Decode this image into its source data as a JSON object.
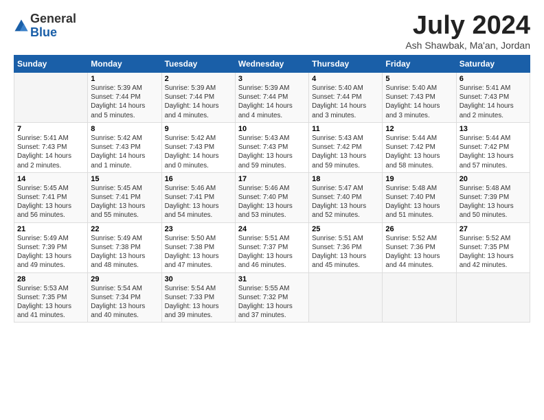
{
  "logo": {
    "general": "General",
    "blue": "Blue"
  },
  "title": "July 2024",
  "subtitle": "Ash Shawbak, Ma'an, Jordan",
  "headers": [
    "Sunday",
    "Monday",
    "Tuesday",
    "Wednesday",
    "Thursday",
    "Friday",
    "Saturday"
  ],
  "weeks": [
    [
      {
        "day": "",
        "info": ""
      },
      {
        "day": "1",
        "info": "Sunrise: 5:39 AM\nSunset: 7:44 PM\nDaylight: 14 hours\nand 5 minutes."
      },
      {
        "day": "2",
        "info": "Sunrise: 5:39 AM\nSunset: 7:44 PM\nDaylight: 14 hours\nand 4 minutes."
      },
      {
        "day": "3",
        "info": "Sunrise: 5:39 AM\nSunset: 7:44 PM\nDaylight: 14 hours\nand 4 minutes."
      },
      {
        "day": "4",
        "info": "Sunrise: 5:40 AM\nSunset: 7:44 PM\nDaylight: 14 hours\nand 3 minutes."
      },
      {
        "day": "5",
        "info": "Sunrise: 5:40 AM\nSunset: 7:43 PM\nDaylight: 14 hours\nand 3 minutes."
      },
      {
        "day": "6",
        "info": "Sunrise: 5:41 AM\nSunset: 7:43 PM\nDaylight: 14 hours\nand 2 minutes."
      }
    ],
    [
      {
        "day": "7",
        "info": "Sunrise: 5:41 AM\nSunset: 7:43 PM\nDaylight: 14 hours\nand 2 minutes."
      },
      {
        "day": "8",
        "info": "Sunrise: 5:42 AM\nSunset: 7:43 PM\nDaylight: 14 hours\nand 1 minute."
      },
      {
        "day": "9",
        "info": "Sunrise: 5:42 AM\nSunset: 7:43 PM\nDaylight: 14 hours\nand 0 minutes."
      },
      {
        "day": "10",
        "info": "Sunrise: 5:43 AM\nSunset: 7:43 PM\nDaylight: 13 hours\nand 59 minutes."
      },
      {
        "day": "11",
        "info": "Sunrise: 5:43 AM\nSunset: 7:42 PM\nDaylight: 13 hours\nand 59 minutes."
      },
      {
        "day": "12",
        "info": "Sunrise: 5:44 AM\nSunset: 7:42 PM\nDaylight: 13 hours\nand 58 minutes."
      },
      {
        "day": "13",
        "info": "Sunrise: 5:44 AM\nSunset: 7:42 PM\nDaylight: 13 hours\nand 57 minutes."
      }
    ],
    [
      {
        "day": "14",
        "info": "Sunrise: 5:45 AM\nSunset: 7:41 PM\nDaylight: 13 hours\nand 56 minutes."
      },
      {
        "day": "15",
        "info": "Sunrise: 5:45 AM\nSunset: 7:41 PM\nDaylight: 13 hours\nand 55 minutes."
      },
      {
        "day": "16",
        "info": "Sunrise: 5:46 AM\nSunset: 7:41 PM\nDaylight: 13 hours\nand 54 minutes."
      },
      {
        "day": "17",
        "info": "Sunrise: 5:46 AM\nSunset: 7:40 PM\nDaylight: 13 hours\nand 53 minutes."
      },
      {
        "day": "18",
        "info": "Sunrise: 5:47 AM\nSunset: 7:40 PM\nDaylight: 13 hours\nand 52 minutes."
      },
      {
        "day": "19",
        "info": "Sunrise: 5:48 AM\nSunset: 7:40 PM\nDaylight: 13 hours\nand 51 minutes."
      },
      {
        "day": "20",
        "info": "Sunrise: 5:48 AM\nSunset: 7:39 PM\nDaylight: 13 hours\nand 50 minutes."
      }
    ],
    [
      {
        "day": "21",
        "info": "Sunrise: 5:49 AM\nSunset: 7:39 PM\nDaylight: 13 hours\nand 49 minutes."
      },
      {
        "day": "22",
        "info": "Sunrise: 5:49 AM\nSunset: 7:38 PM\nDaylight: 13 hours\nand 48 minutes."
      },
      {
        "day": "23",
        "info": "Sunrise: 5:50 AM\nSunset: 7:38 PM\nDaylight: 13 hours\nand 47 minutes."
      },
      {
        "day": "24",
        "info": "Sunrise: 5:51 AM\nSunset: 7:37 PM\nDaylight: 13 hours\nand 46 minutes."
      },
      {
        "day": "25",
        "info": "Sunrise: 5:51 AM\nSunset: 7:36 PM\nDaylight: 13 hours\nand 45 minutes."
      },
      {
        "day": "26",
        "info": "Sunrise: 5:52 AM\nSunset: 7:36 PM\nDaylight: 13 hours\nand 44 minutes."
      },
      {
        "day": "27",
        "info": "Sunrise: 5:52 AM\nSunset: 7:35 PM\nDaylight: 13 hours\nand 42 minutes."
      }
    ],
    [
      {
        "day": "28",
        "info": "Sunrise: 5:53 AM\nSunset: 7:35 PM\nDaylight: 13 hours\nand 41 minutes."
      },
      {
        "day": "29",
        "info": "Sunrise: 5:54 AM\nSunset: 7:34 PM\nDaylight: 13 hours\nand 40 minutes."
      },
      {
        "day": "30",
        "info": "Sunrise: 5:54 AM\nSunset: 7:33 PM\nDaylight: 13 hours\nand 39 minutes."
      },
      {
        "day": "31",
        "info": "Sunrise: 5:55 AM\nSunset: 7:32 PM\nDaylight: 13 hours\nand 37 minutes."
      },
      {
        "day": "",
        "info": ""
      },
      {
        "day": "",
        "info": ""
      },
      {
        "day": "",
        "info": ""
      }
    ]
  ]
}
